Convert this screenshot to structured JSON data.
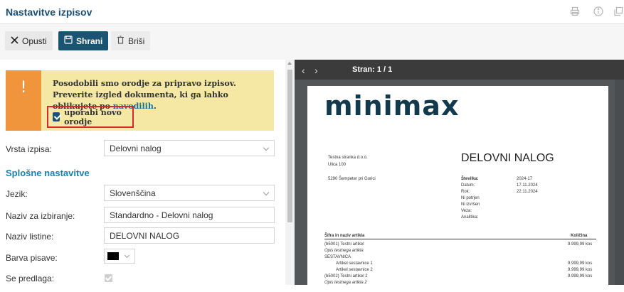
{
  "header": {
    "title": "Nastavitve izpisov"
  },
  "toolbar": {
    "cancel": "Opusti",
    "save": "Shrani",
    "delete": "Briši"
  },
  "notice": {
    "text": "Posodobili smo orodje za pripravo izpisov. Preverite izgled dokumenta, ki ga lahko oblikujete po ",
    "link": "navodilih",
    "suffix": ".",
    "checkbox_label": "uporabi novo orodje"
  },
  "form": {
    "print_type_label": "Vrsta izpisa:",
    "print_type_value": "Delovni nalog",
    "section_title": "Splošne nastavitve",
    "language_label": "Jezik:",
    "language_value": "Slovenščina",
    "selection_name_label": "Naziv za izbiranje:",
    "selection_name_value": "Standardno - Delovni nalog",
    "document_name_label": "Naziv listine:",
    "document_name_value": "DELOVNI NALOG",
    "font_color_label": "Barva pisave:",
    "font_color": "#000000",
    "template_label": "Se predlaga:"
  },
  "preview": {
    "page_label": "Stran: 1 / 1",
    "logo": "minimax",
    "company": [
      "Testna stranka d.o.o.",
      "Ulica 100",
      "5290 Šempeter pri Gorici"
    ],
    "doc_title": "DELOVNI NALOG",
    "meta": [
      {
        "k": "Številka:",
        "v": "2024-17"
      },
      {
        "k": "Datum:",
        "v": "17.11.2024"
      },
      {
        "k": "Rok:",
        "v": "22.11.2024"
      },
      {
        "k": "Ni potrjen",
        "v": ""
      },
      {
        "k": "Ni izvršen",
        "v": ""
      },
      {
        "k": "Veza:",
        "v": ""
      },
      {
        "k": "Analitika:",
        "v": ""
      }
    ],
    "table_header_left": "Šifra in naziv artikla",
    "table_header_right": "Količina",
    "rows": [
      {
        "name": "(b5001) Testni artikel",
        "qty": "9.999,99 kos"
      },
      {
        "name": "Opis testnega artikla",
        "qty": ""
      },
      {
        "name": "SESTAVNICA",
        "qty": ""
      },
      {
        "name": "Artikel sestavnice 1",
        "qty": "9.999,99 kos"
      },
      {
        "name": "Artikel sestavnice 2",
        "qty": "9.999,99 kos"
      },
      {
        "name": "(b5002) Testni artikel 2",
        "qty": "9.999,99 kos"
      },
      {
        "name": "Opis testnega artikla 2",
        "qty": ""
      }
    ]
  }
}
